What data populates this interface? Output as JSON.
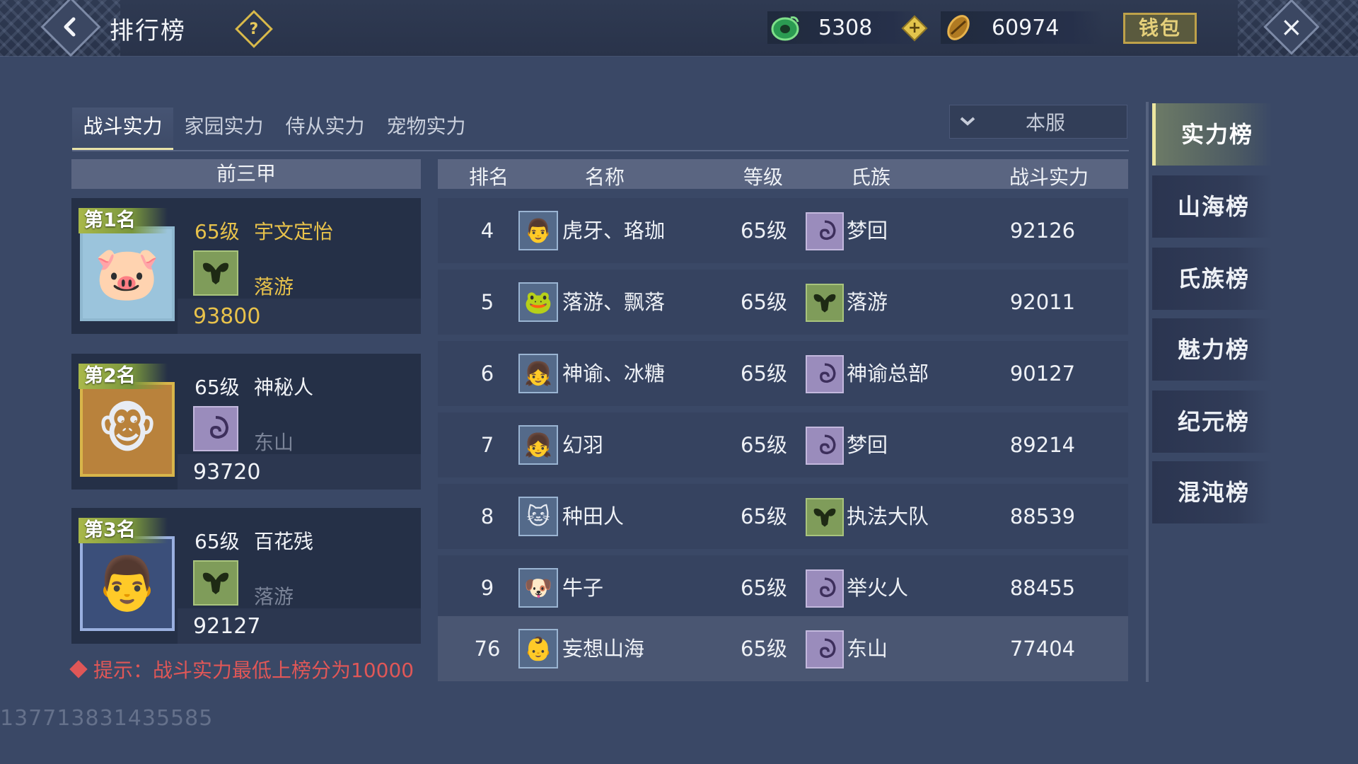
{
  "header": {
    "title": "排行榜",
    "currency_jade": "5308",
    "currency_coin": "60974",
    "wallet_label": "钱包"
  },
  "tabs": [
    {
      "label": "战斗实力",
      "active": true
    },
    {
      "label": "家园实力",
      "active": false
    },
    {
      "label": "侍从实力",
      "active": false
    },
    {
      "label": "宠物实力",
      "active": false
    }
  ],
  "server_select": {
    "value": "本服"
  },
  "top3": {
    "header": "前三甲",
    "cards": [
      {
        "rank_label": "第1名",
        "level": "65级",
        "name": "宇文定怡",
        "clan": "落游",
        "power": "93800",
        "avatar": "pig",
        "clan_color": "green",
        "highlight": true
      },
      {
        "rank_label": "第2名",
        "level": "65级",
        "name": "神秘人",
        "clan": "东山",
        "power": "93720",
        "avatar": "monkey",
        "clan_color": "purple",
        "highlight": false
      },
      {
        "rank_label": "第3名",
        "level": "65级",
        "name": "百花残",
        "clan": "落游",
        "power": "92127",
        "avatar": "man",
        "clan_color": "green",
        "highlight": false
      }
    ]
  },
  "hint": "提示：战斗实力最低上榜分为10000",
  "uid": "137713831435585",
  "table": {
    "headers": {
      "rank": "排名",
      "name": "名称",
      "level": "等级",
      "clan": "氏族",
      "power": "战斗实力"
    },
    "rows": [
      {
        "rank": "4",
        "name": "虎牙、珞珈",
        "level": "65级",
        "clan": "梦回",
        "power": "92126",
        "clan_color": "purple",
        "avatar": "man"
      },
      {
        "rank": "5",
        "name": "落游、飘落",
        "level": "65级",
        "clan": "落游",
        "power": "92011",
        "clan_color": "green",
        "avatar": "frog"
      },
      {
        "rank": "6",
        "name": "神谕、冰糖",
        "level": "65级",
        "clan": "神谕总部",
        "power": "90127",
        "clan_color": "purple",
        "avatar": "girl"
      },
      {
        "rank": "7",
        "name": "幻羽",
        "level": "65级",
        "clan": "梦回",
        "power": "89214",
        "clan_color": "purple",
        "avatar": "girl"
      },
      {
        "rank": "8",
        "name": "种田人",
        "level": "65级",
        "clan": "执法大队",
        "power": "88539",
        "clan_color": "green",
        "avatar": "cat"
      },
      {
        "rank": "9",
        "name": "牛子",
        "level": "65级",
        "clan": "举火人",
        "power": "88455",
        "clan_color": "purple",
        "avatar": "pet"
      },
      {
        "rank": "76",
        "name": "妄想山海",
        "level": "65级",
        "clan": "东山",
        "power": "77404",
        "clan_color": "purple",
        "avatar": "baby",
        "self": true
      }
    ]
  },
  "categories": [
    {
      "label": "实力榜",
      "active": true
    },
    {
      "label": "山海榜",
      "active": false
    },
    {
      "label": "氏族榜",
      "active": false
    },
    {
      "label": "魅力榜",
      "active": false
    },
    {
      "label": "纪元榜",
      "active": false
    },
    {
      "label": "混沌榜",
      "active": false
    }
  ],
  "icons": {
    "back": "back-arrow-icon",
    "help": "question-icon",
    "jade": "jade-currency-icon",
    "coin": "shell-currency-icon",
    "plus": "plus-icon",
    "close": "close-icon",
    "dropdown": "chevron-down-icon",
    "clan_green": "ram-emblem-icon",
    "clan_purple": "swirl-emblem-icon"
  },
  "colors": {
    "accent_gold": "#e8c24b",
    "hint_red": "#e05757",
    "clan_green": "#7f9c5a",
    "clan_purple": "#9a8cbc"
  }
}
